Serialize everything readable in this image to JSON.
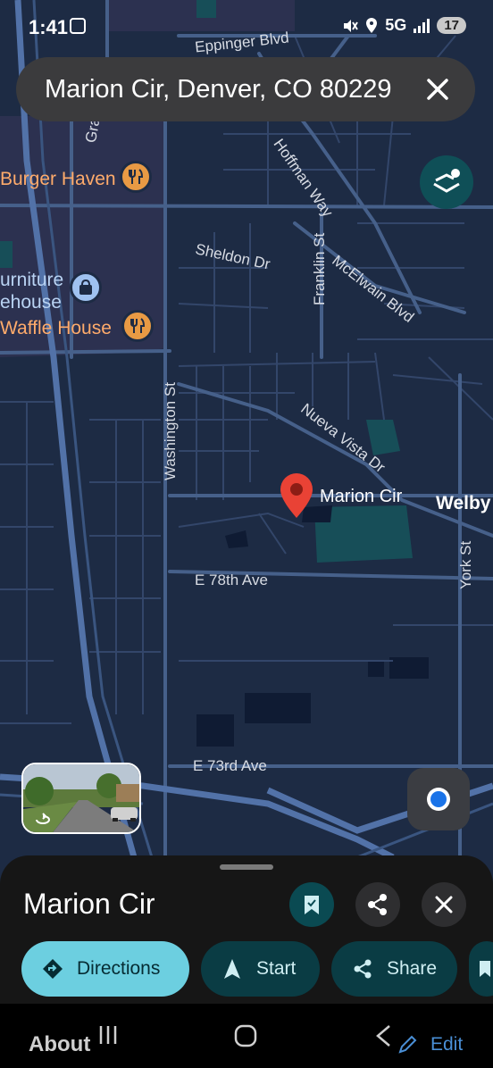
{
  "status_bar": {
    "time": "1:41",
    "network": "5G",
    "battery": "17"
  },
  "search": {
    "query": "Marion Cir, Denver, CO 80229"
  },
  "map": {
    "streets": [
      "Eppinger Blvd",
      "Grant",
      "Hoffman Way",
      "Sheldon Dr",
      "Franklin St",
      "McElwain Blvd",
      "Washington St",
      "Nueva Vista Dr",
      "E 78th Ave",
      "York St",
      "E 73rd Ave"
    ],
    "places": {
      "burger_haven": "Burger Haven",
      "furniture_1": "urniture",
      "furniture_2": "ehouse",
      "waffle_house": "Waffle House",
      "welby": "Welby"
    },
    "pin_label": "Marion Cir",
    "icons": {
      "restaurant": "restaurant-icon",
      "store": "shopping-bag-icon",
      "layers": "layers-icon",
      "pin": "location-pin-icon",
      "street_view": "street-view-icon",
      "my_location": "my-location-icon"
    }
  },
  "sheet": {
    "title": "Marion Cir",
    "chips": {
      "directions": "Directions",
      "start": "Start",
      "share": "Share"
    }
  },
  "navbar": {
    "about": "About",
    "edit": "Edit"
  },
  "colors": {
    "map_background": "#1d2b44",
    "road": "#46608a",
    "pin": "#e94235",
    "directions_chip": "#6ccfe0",
    "teal_chip": "#0a3c44"
  }
}
